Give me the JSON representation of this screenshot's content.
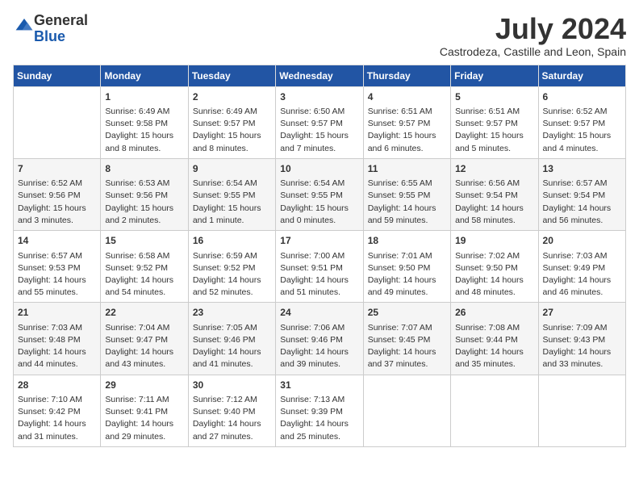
{
  "logo": {
    "general": "General",
    "blue": "Blue"
  },
  "title": "July 2024",
  "location": "Castrodeza, Castille and Leon, Spain",
  "days_header": [
    "Sunday",
    "Monday",
    "Tuesday",
    "Wednesday",
    "Thursday",
    "Friday",
    "Saturday"
  ],
  "weeks": [
    [
      {
        "day": "",
        "text": ""
      },
      {
        "day": "1",
        "text": "Sunrise: 6:49 AM\nSunset: 9:58 PM\nDaylight: 15 hours\nand 8 minutes."
      },
      {
        "day": "2",
        "text": "Sunrise: 6:49 AM\nSunset: 9:57 PM\nDaylight: 15 hours\nand 8 minutes."
      },
      {
        "day": "3",
        "text": "Sunrise: 6:50 AM\nSunset: 9:57 PM\nDaylight: 15 hours\nand 7 minutes."
      },
      {
        "day": "4",
        "text": "Sunrise: 6:51 AM\nSunset: 9:57 PM\nDaylight: 15 hours\nand 6 minutes."
      },
      {
        "day": "5",
        "text": "Sunrise: 6:51 AM\nSunset: 9:57 PM\nDaylight: 15 hours\nand 5 minutes."
      },
      {
        "day": "6",
        "text": "Sunrise: 6:52 AM\nSunset: 9:57 PM\nDaylight: 15 hours\nand 4 minutes."
      }
    ],
    [
      {
        "day": "7",
        "text": "Sunrise: 6:52 AM\nSunset: 9:56 PM\nDaylight: 15 hours\nand 3 minutes."
      },
      {
        "day": "8",
        "text": "Sunrise: 6:53 AM\nSunset: 9:56 PM\nDaylight: 15 hours\nand 2 minutes."
      },
      {
        "day": "9",
        "text": "Sunrise: 6:54 AM\nSunset: 9:55 PM\nDaylight: 15 hours\nand 1 minute."
      },
      {
        "day": "10",
        "text": "Sunrise: 6:54 AM\nSunset: 9:55 PM\nDaylight: 15 hours\nand 0 minutes."
      },
      {
        "day": "11",
        "text": "Sunrise: 6:55 AM\nSunset: 9:55 PM\nDaylight: 14 hours\nand 59 minutes."
      },
      {
        "day": "12",
        "text": "Sunrise: 6:56 AM\nSunset: 9:54 PM\nDaylight: 14 hours\nand 58 minutes."
      },
      {
        "day": "13",
        "text": "Sunrise: 6:57 AM\nSunset: 9:54 PM\nDaylight: 14 hours\nand 56 minutes."
      }
    ],
    [
      {
        "day": "14",
        "text": "Sunrise: 6:57 AM\nSunset: 9:53 PM\nDaylight: 14 hours\nand 55 minutes."
      },
      {
        "day": "15",
        "text": "Sunrise: 6:58 AM\nSunset: 9:52 PM\nDaylight: 14 hours\nand 54 minutes."
      },
      {
        "day": "16",
        "text": "Sunrise: 6:59 AM\nSunset: 9:52 PM\nDaylight: 14 hours\nand 52 minutes."
      },
      {
        "day": "17",
        "text": "Sunrise: 7:00 AM\nSunset: 9:51 PM\nDaylight: 14 hours\nand 51 minutes."
      },
      {
        "day": "18",
        "text": "Sunrise: 7:01 AM\nSunset: 9:50 PM\nDaylight: 14 hours\nand 49 minutes."
      },
      {
        "day": "19",
        "text": "Sunrise: 7:02 AM\nSunset: 9:50 PM\nDaylight: 14 hours\nand 48 minutes."
      },
      {
        "day": "20",
        "text": "Sunrise: 7:03 AM\nSunset: 9:49 PM\nDaylight: 14 hours\nand 46 minutes."
      }
    ],
    [
      {
        "day": "21",
        "text": "Sunrise: 7:03 AM\nSunset: 9:48 PM\nDaylight: 14 hours\nand 44 minutes."
      },
      {
        "day": "22",
        "text": "Sunrise: 7:04 AM\nSunset: 9:47 PM\nDaylight: 14 hours\nand 43 minutes."
      },
      {
        "day": "23",
        "text": "Sunrise: 7:05 AM\nSunset: 9:46 PM\nDaylight: 14 hours\nand 41 minutes."
      },
      {
        "day": "24",
        "text": "Sunrise: 7:06 AM\nSunset: 9:46 PM\nDaylight: 14 hours\nand 39 minutes."
      },
      {
        "day": "25",
        "text": "Sunrise: 7:07 AM\nSunset: 9:45 PM\nDaylight: 14 hours\nand 37 minutes."
      },
      {
        "day": "26",
        "text": "Sunrise: 7:08 AM\nSunset: 9:44 PM\nDaylight: 14 hours\nand 35 minutes."
      },
      {
        "day": "27",
        "text": "Sunrise: 7:09 AM\nSunset: 9:43 PM\nDaylight: 14 hours\nand 33 minutes."
      }
    ],
    [
      {
        "day": "28",
        "text": "Sunrise: 7:10 AM\nSunset: 9:42 PM\nDaylight: 14 hours\nand 31 minutes."
      },
      {
        "day": "29",
        "text": "Sunrise: 7:11 AM\nSunset: 9:41 PM\nDaylight: 14 hours\nand 29 minutes."
      },
      {
        "day": "30",
        "text": "Sunrise: 7:12 AM\nSunset: 9:40 PM\nDaylight: 14 hours\nand 27 minutes."
      },
      {
        "day": "31",
        "text": "Sunrise: 7:13 AM\nSunset: 9:39 PM\nDaylight: 14 hours\nand 25 minutes."
      },
      {
        "day": "",
        "text": ""
      },
      {
        "day": "",
        "text": ""
      },
      {
        "day": "",
        "text": ""
      }
    ]
  ]
}
